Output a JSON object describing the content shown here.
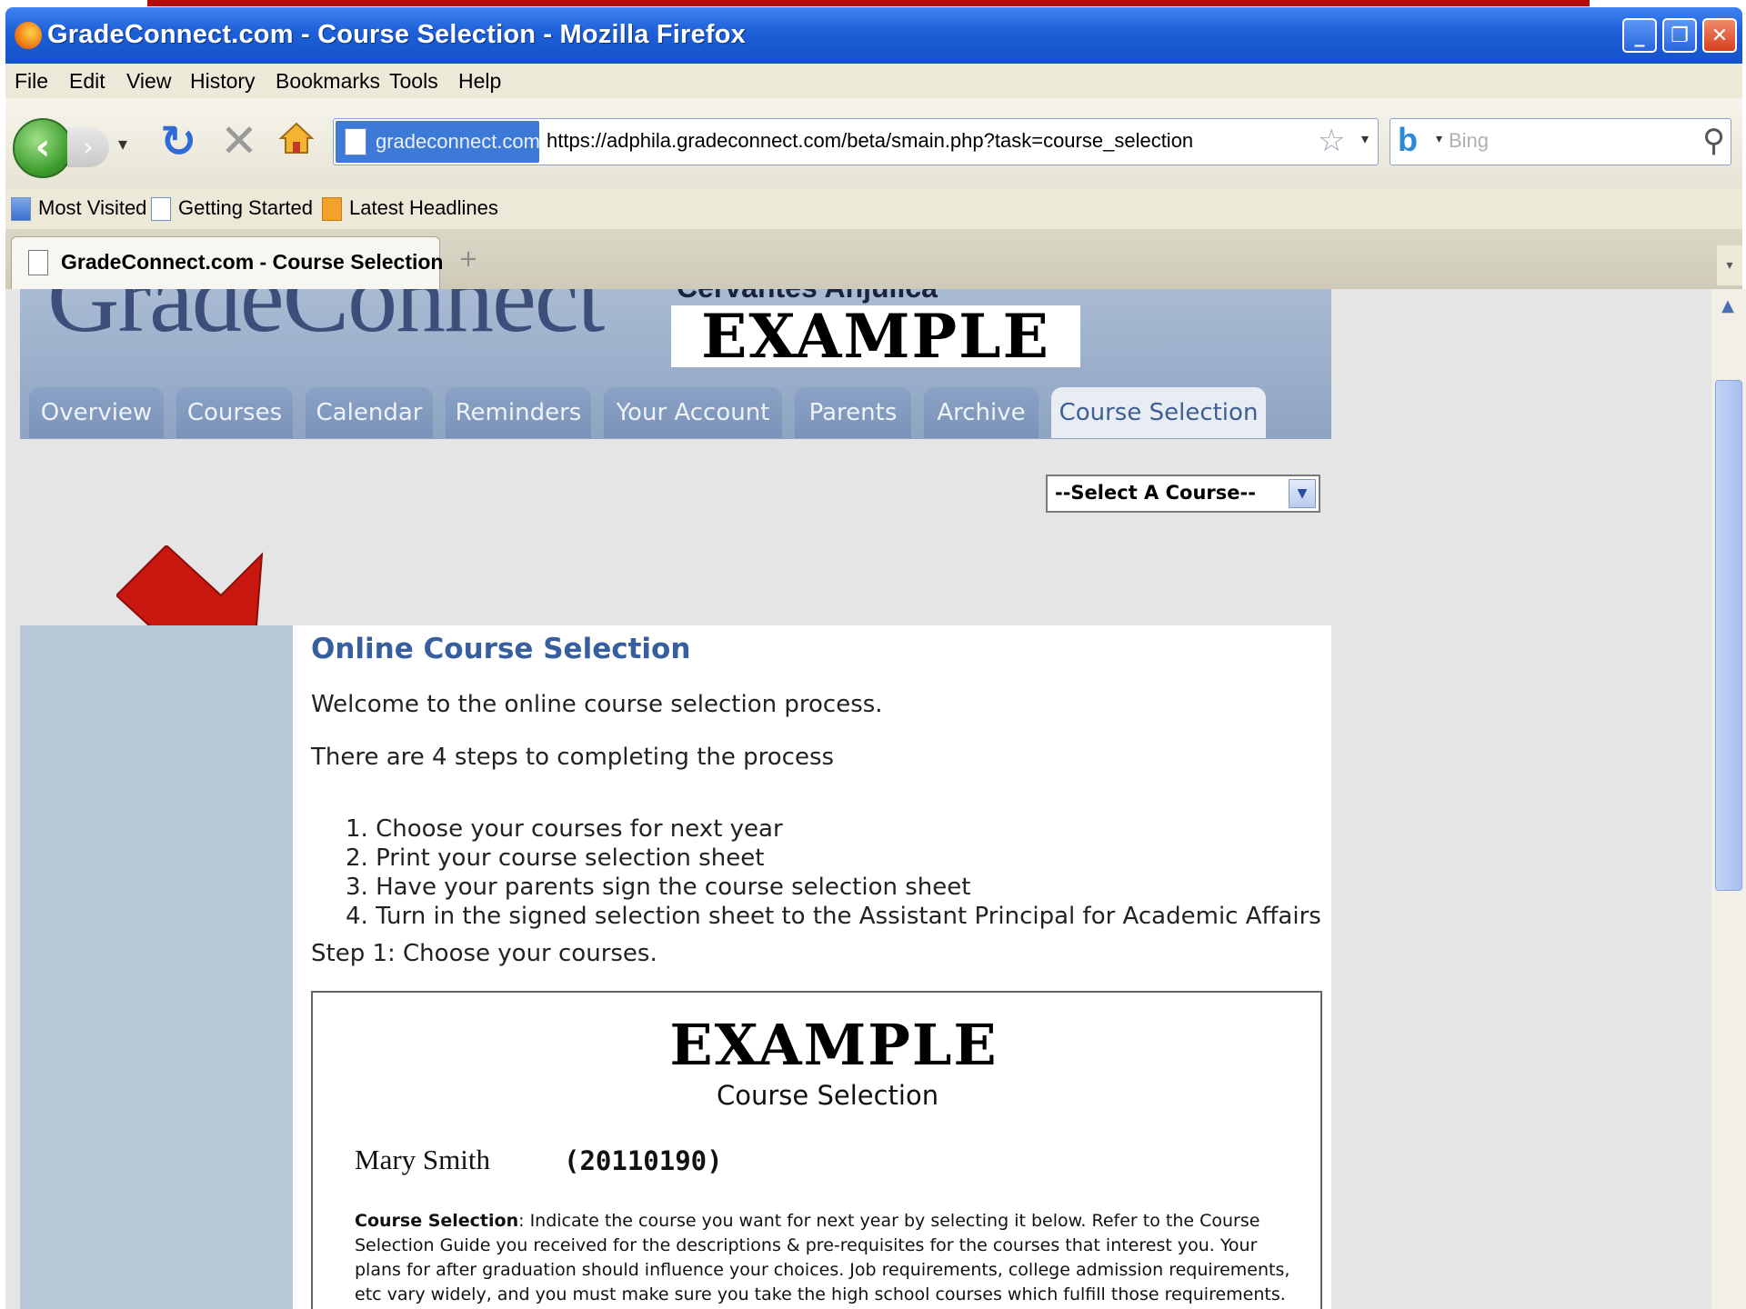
{
  "window": {
    "title": "GradeConnect.com - Course Selection - Mozilla Firefox"
  },
  "menu": [
    "File",
    "Edit",
    "View",
    "History",
    "Bookmarks",
    "Tools",
    "Help"
  ],
  "navbar": {
    "site_identity": "gradeconnect.com",
    "url": "https://adphila.gradeconnect.com/beta/smain.php?task=course_selection",
    "search_placeholder": "Bing"
  },
  "bookmarks": [
    {
      "label": "Most Visited",
      "icon": "bookmark-folder-icon"
    },
    {
      "label": "Getting Started",
      "icon": "page-icon"
    },
    {
      "label": "Latest Headlines",
      "icon": "rss-icon"
    }
  ],
  "tab": {
    "label": "GradeConnect.com - Course Selection"
  },
  "site": {
    "logo": "GradeConnect",
    "partial_name": "Cervantes Anjulica",
    "banner": "EXAMPLE",
    "nav_tabs": [
      "Overview",
      "Courses",
      "Calendar",
      "Reminders",
      "Your Account",
      "Parents",
      "Archive",
      "Course Selection"
    ],
    "active_tab": "Course Selection",
    "course_dropdown": "--Select A Course--"
  },
  "main": {
    "title": "Online Course Selection",
    "welcome": "Welcome to the online course selection process.",
    "steps_intro": "There are 4 steps to completing the process",
    "steps": [
      "1.  Choose your courses for next year",
      "2.  Print your course selection sheet",
      "3.  Have your parents sign the course selection sheet",
      "4.  Turn in the signed selection sheet to the Assistant Principal for Academic Affairs"
    ],
    "step1": "Step 1: Choose your courses."
  },
  "form": {
    "banner": "EXAMPLE",
    "subtitle": "Course Selection",
    "student_name": "Mary Smith",
    "student_id": "(20110190)",
    "instructions_label": "Course Selection",
    "instructions_text": ": Indicate the course you want for next year by selecting it below. Refer to the Course Selection Guide you received for the descriptions & pre-requisites for the courses that interest you. Your plans for after graduation should influence your choices. Job requirements, college admission requirements, etc vary widely, and you must make sure you take the high school courses which fulfill those requirements."
  },
  "colors": {
    "titlebar": "#1d5fd7",
    "site_header": "#8ea4c2",
    "active_tab_text": "#3d5f95",
    "arrow": "#c81810"
  }
}
